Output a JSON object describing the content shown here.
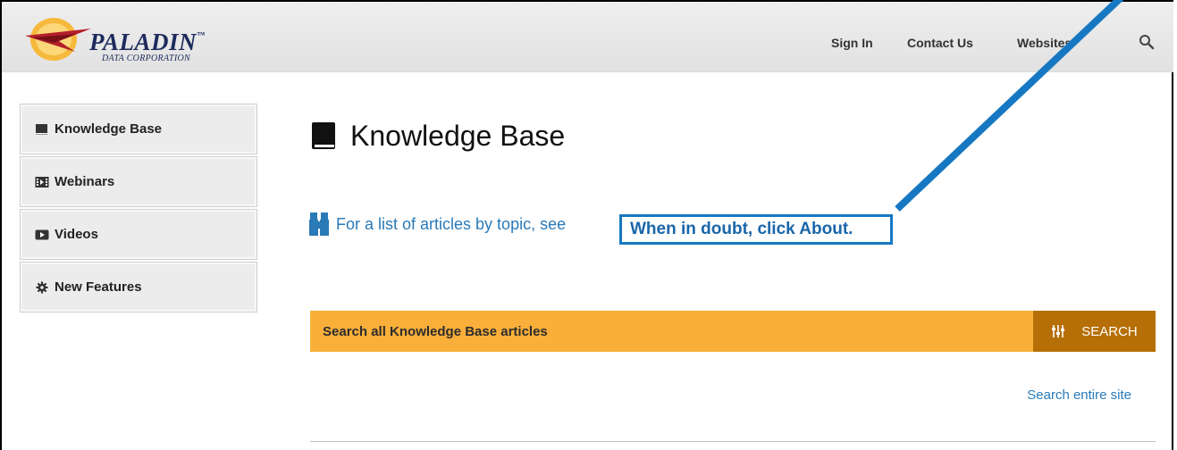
{
  "header": {
    "logo": {
      "name": "PALADIN",
      "tm": "™",
      "subtitle": "DATA CORPORATION"
    },
    "nav": [
      {
        "label": "Sign In"
      },
      {
        "label": "Contact Us"
      },
      {
        "label": "Websites"
      }
    ],
    "search_icon": "search-icon"
  },
  "sidebar": {
    "items": [
      {
        "label": "Knowledge Base",
        "icon": "book-icon"
      },
      {
        "label": "Webinars",
        "icon": "film-icon"
      },
      {
        "label": "Videos",
        "icon": "video-icon"
      },
      {
        "label": "New Features",
        "icon": "gear-icon"
      }
    ]
  },
  "main": {
    "title": "Knowledge Base",
    "info_text": "For a list of articles by topic, see",
    "highlight_text": "When in doubt, click About.",
    "search": {
      "label": "Search all Knowledge Base articles",
      "button_label": "SEARCH"
    },
    "search_site_link": "Search entire site"
  },
  "colors": {
    "search_bar": "#f9af3a",
    "search_button": "#b56f06",
    "link_blue": "#2a7ab8",
    "annotation_blue": "#1678c2"
  }
}
